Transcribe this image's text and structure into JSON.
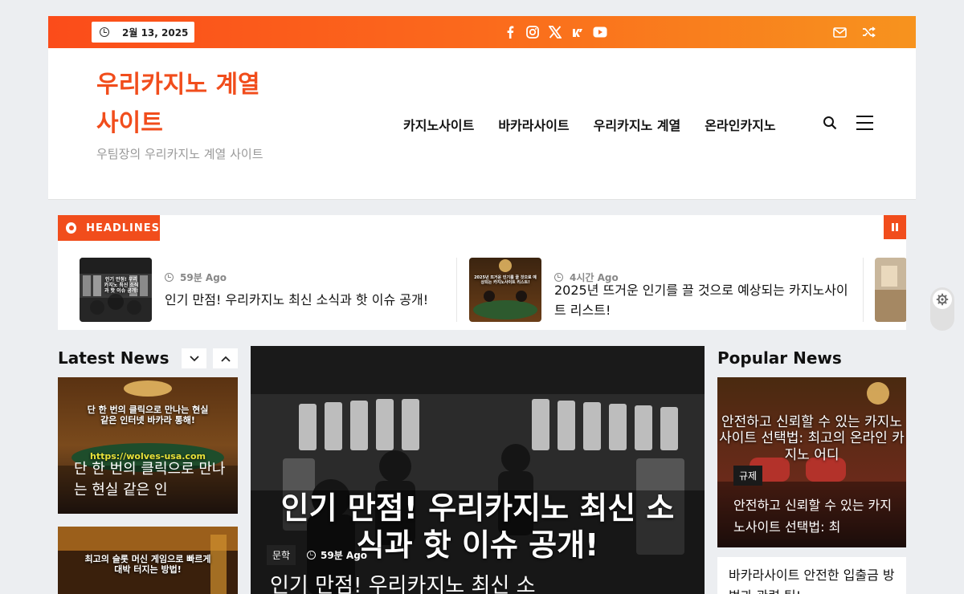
{
  "topbar": {
    "date": "2월 13, 2025",
    "socials": [
      "facebook-icon",
      "instagram-icon",
      "x-icon",
      "vk-icon",
      "youtube-icon"
    ],
    "right_icons": [
      "mail-icon",
      "shuffle-icon"
    ]
  },
  "header": {
    "site_title": "우리카지노 계열 사이트",
    "tagline": "우팀장의 우리카지노 계열 사이트",
    "nav": [
      "카지노사이트",
      "바카라사이트",
      "우리카지노 계열",
      "온라인카지노"
    ]
  },
  "headlines": {
    "badge": "HEADLINES",
    "items": [
      {
        "time": "59분 Ago",
        "title": "인기 만점! 우리카지노 최신 소식과 핫 이슈 공개!",
        "thumb_text": "인기 만점! 우리카지노 최신 소식과 핫 이슈 공개!"
      },
      {
        "time": "4시간 Ago",
        "title": "2025년 뜨거운 인기를 끌 것으로 예상되는 카지노사이트 리스트!",
        "thumb_text": "2025년 뜨거운 인기를 끌 것으로 예상되는 카지노사이트 리스트!"
      }
    ]
  },
  "latest": {
    "title": "Latest News",
    "cards": [
      {
        "image_text": "단 한 번의 클릭으로 만나는 현실 같은 인터넷 바카라 통해!",
        "image_url": "https://wolves-usa.com",
        "caption": "단 한 번의 클릭으로 만나는 현실 같은 인"
      },
      {
        "image_text": "최고의 슬롯 머신 게임으로 빠르게 대박 터지는 방법!"
      }
    ]
  },
  "featured": {
    "image_text": "인기 만점! 우리카지노 최신 소식과 핫 이슈 공개!",
    "category": "문학",
    "time": "59분 Ago",
    "title": "인기 만점! 우리카지노 최신 소"
  },
  "popular": {
    "title": "Popular News",
    "card": {
      "image_text": "안전하고 신뢰할 수 있는 카지노사이트 선택법: 최고의 온라인 카지노 어디",
      "category": "규제",
      "caption": "안전하고 신뢰할 수 있는 카지노사이트 선택법: 최"
    },
    "list_item": "바카라사이트 안전한 입출금 방법과 관련 팁!"
  },
  "colors": {
    "accent": "#f14d1c",
    "topbar_start": "#fb4c1a",
    "topbar_end": "#f7931e"
  }
}
